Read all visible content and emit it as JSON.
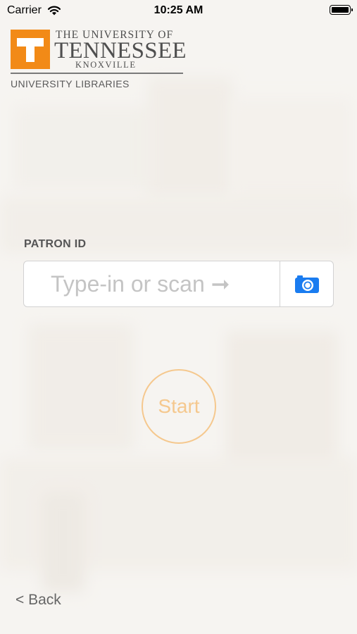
{
  "status_bar": {
    "carrier": "Carrier",
    "time": "10:25 AM"
  },
  "logo": {
    "mark": "T",
    "line1": "THE UNIVERSITY OF",
    "line2": "TENNESSEE",
    "line3": "KNOXVILLE",
    "subtitle": "UNIVERSITY LIBRARIES",
    "brand_color": "#f28a17"
  },
  "form": {
    "label": "PATRON ID",
    "placeholder": "Type-in or scan ➞",
    "value": "",
    "scan_icon": "camera-icon",
    "accent_color": "#1a7cf0"
  },
  "start_label": "Start",
  "back_label": "< Back"
}
